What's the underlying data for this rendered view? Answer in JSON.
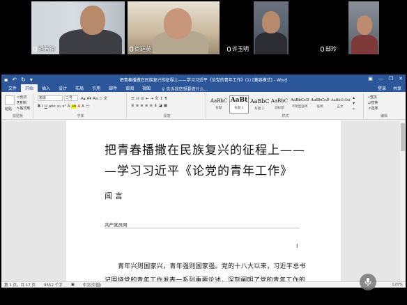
{
  "participants": [
    {
      "name": "赵若渝"
    },
    {
      "name": "尚廷英"
    },
    {
      "name": "许玉明"
    },
    {
      "name": "邸玲"
    }
  ],
  "word": {
    "window_title": "把青春播撒在民族复兴的征程上——学习习近平《论党的青年工作》(1) [兼容模式] - Word",
    "tabs": [
      "文件",
      "开始",
      "插入",
      "设计",
      "布局",
      "引用",
      "邮件",
      "审阅",
      "视图"
    ],
    "active_tab": "开始",
    "tell_me": "告诉我您想要做什么...",
    "right_tabs": [
      "登录",
      "共享"
    ],
    "ribbon": {
      "clipboard_label": "剪贴板",
      "paste": "粘贴",
      "cut": "剪切",
      "copy": "复制",
      "format_painter": "格式刷",
      "font_label": "字体",
      "font_name": "宋体",
      "font_size": "二号",
      "paragraph_label": "段落",
      "styles_label": "样式",
      "styles": [
        {
          "preview": "AaBbC",
          "name": "标题"
        },
        {
          "preview": "AaBt",
          "name": "标题 1"
        },
        {
          "preview": "AaBbC",
          "name": "标题 2"
        },
        {
          "preview": "AaBbC",
          "name": "副标题"
        },
        {
          "preview": "AaBbCcD",
          "name": "不明显强调"
        },
        {
          "preview": "AaBbCcD",
          "name": "强调"
        },
        {
          "preview": "AaBbCcDd",
          "name": "正文"
        }
      ],
      "editing_label": "编辑",
      "find": "查找",
      "replace": "替换",
      "select": "选择"
    },
    "document": {
      "title_line1": "把青春播撒在民族复兴的征程上——",
      "title_line2": "—学习习近平《论党的青年工作》",
      "author": "闻言",
      "source": "共产党员网",
      "para1": "青年兴则国家兴，青年强则国家强。党的十八大以来，习近平总书",
      "para2": "记围绕党的青年工作发表一系列重要论述，深刻阐明了党的青年工作的"
    },
    "status": {
      "page": "第 1 页，共 17 页",
      "words": "9552 个字",
      "lang": "中文(中国)",
      "zoom": "120%"
    }
  }
}
